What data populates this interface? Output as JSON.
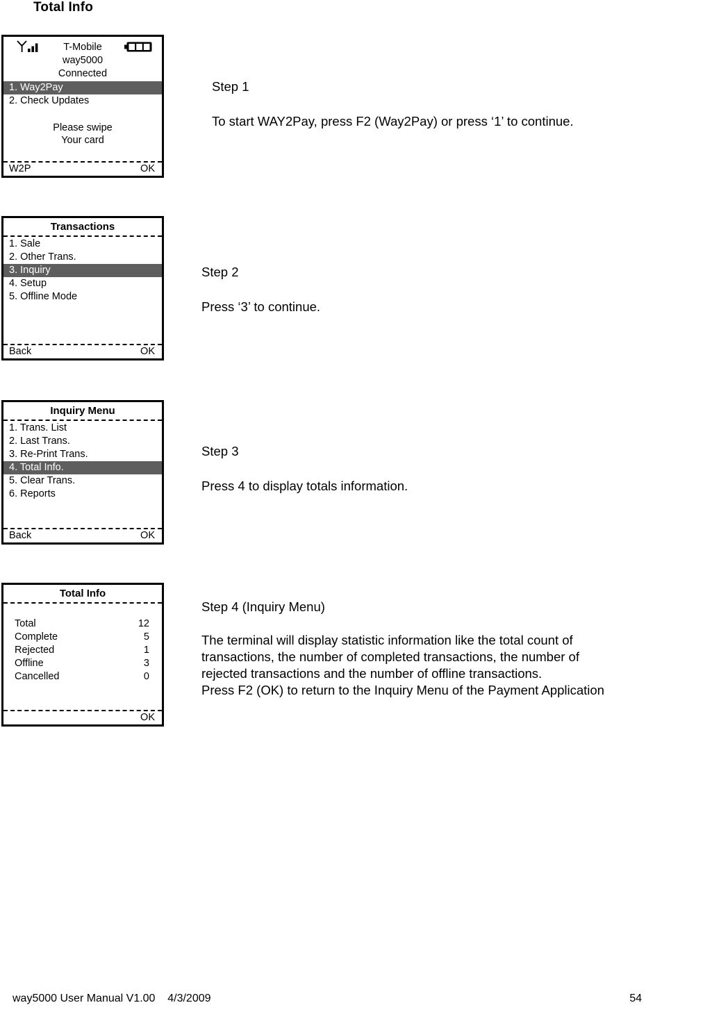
{
  "page": {
    "title": "Total Info"
  },
  "terminals": [
    {
      "id": "home-screen",
      "statusbar": {
        "signal_icon": "signal-antenna-icon",
        "battery_icon": "battery-full-icon"
      },
      "header_lines": [
        "T-Mobile",
        "way5000",
        "Connected"
      ],
      "menu": [
        {
          "label": "1. Way2Pay",
          "selected": true
        },
        {
          "label": "2. Check Updates",
          "selected": false
        }
      ],
      "prompt_lines": [
        "Please swipe",
        "Your card"
      ],
      "softkeys": {
        "left": "W2P",
        "right": "OK"
      }
    },
    {
      "id": "transactions-screen",
      "title": "Transactions",
      "menu": [
        {
          "label": "1. Sale",
          "selected": false
        },
        {
          "label": "2. Other Trans.",
          "selected": false
        },
        {
          "label": "3. Inquiry",
          "selected": true
        },
        {
          "label": "4. Setup",
          "selected": false
        },
        {
          "label": "5. Offline Mode",
          "selected": false
        }
      ],
      "softkeys": {
        "left": "Back",
        "right": "OK"
      }
    },
    {
      "id": "inquiry-menu-screen",
      "title": "Inquiry Menu",
      "menu": [
        {
          "label": "1. Trans. List",
          "selected": false
        },
        {
          "label": "2. Last Trans.",
          "selected": false
        },
        {
          "label": "3. Re-Print Trans.",
          "selected": false
        },
        {
          "label": "4. Total Info.",
          "selected": true
        },
        {
          "label": "5. Clear Trans.",
          "selected": false
        },
        {
          "label": "6. Reports",
          "selected": false
        }
      ],
      "softkeys": {
        "left": "Back",
        "right": "OK"
      }
    },
    {
      "id": "total-info-screen",
      "title": "Total Info",
      "totals": [
        {
          "label": "Total",
          "value": "12"
        },
        {
          "label": "Complete",
          "value": "5"
        },
        {
          "label": "Rejected",
          "value": "1"
        },
        {
          "label": "Offline",
          "value": "3"
        },
        {
          "label": "Cancelled",
          "value": "0"
        }
      ],
      "softkeys": {
        "left": "",
        "right": "OK"
      }
    }
  ],
  "steps": [
    {
      "heading": "Step 1",
      "lines": [
        "To start WAY2Pay, press F2 (Way2Pay) or press ‘1’ to continue."
      ]
    },
    {
      "heading": "Step 2",
      "lines": [
        "Press ‘3’ to continue."
      ]
    },
    {
      "heading": "Step 3",
      "lines": [
        "Press 4 to display totals information."
      ]
    },
    {
      "heading": "Step 4 (Inquiry Menu)",
      "lines": [
        "The terminal will display statistic information like the total count of",
        "transactions, the number of completed transactions, the number of",
        "rejected transactions and the number of offline transactions.",
        "Press F2 (OK) to return to the Inquiry Menu of the Payment Application"
      ]
    }
  ],
  "footer": {
    "manual": "way5000 User Manual V1.00",
    "date": "4/3/2009",
    "page_number": "54"
  },
  "colors": {
    "highlight": "#5e5e5e",
    "highlight_text": "#ffffff",
    "border": "#000000",
    "background": "#ffffff"
  }
}
